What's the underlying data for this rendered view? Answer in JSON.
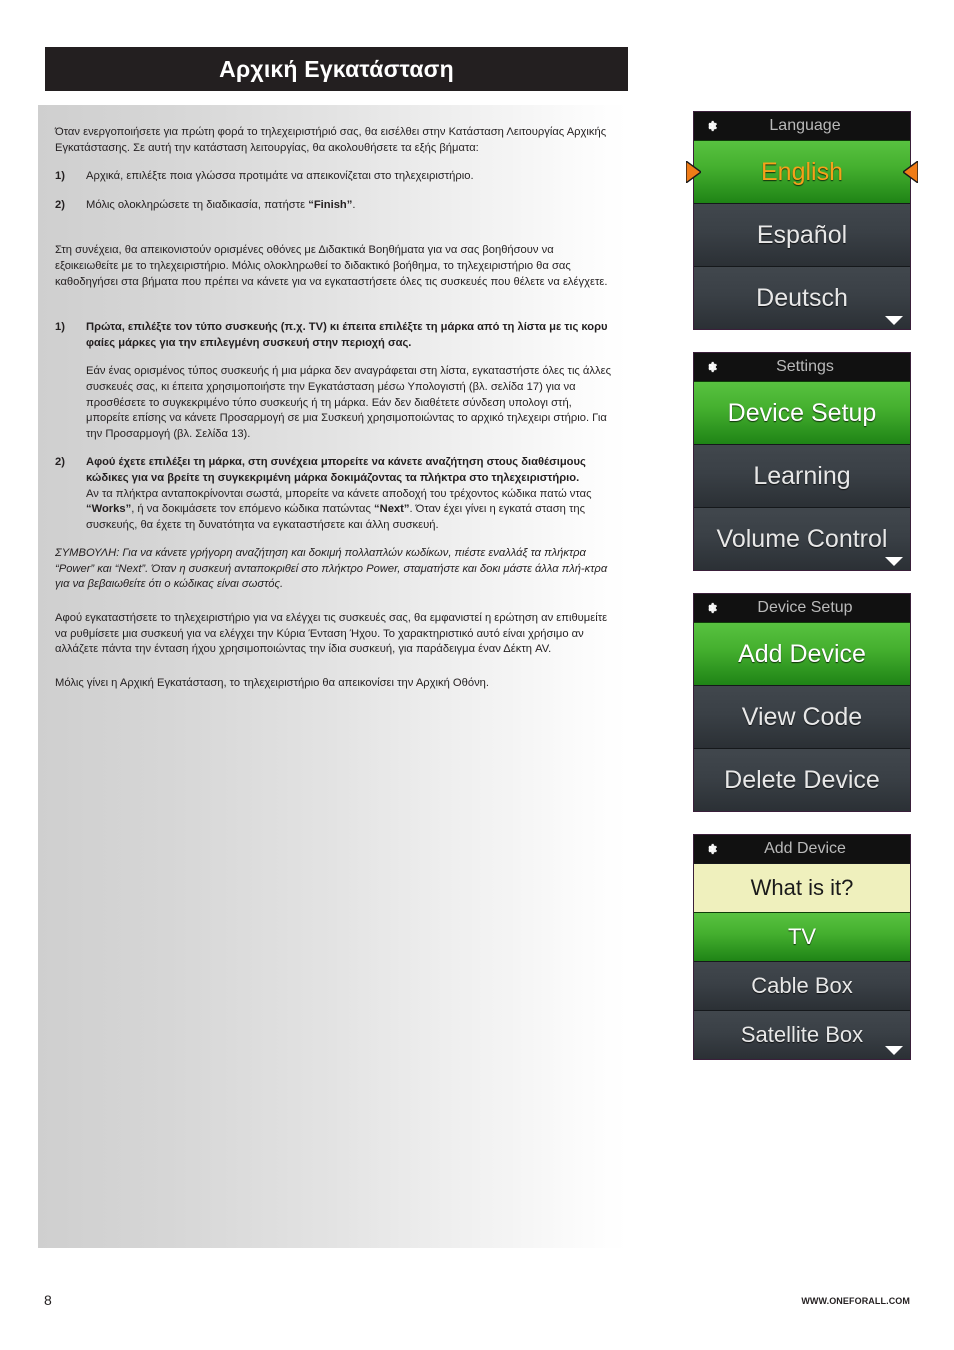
{
  "page": {
    "title": "Αρχική Εγκατάσταση",
    "number": "8",
    "website": "WWW.ONEFORALL.COM"
  },
  "body": {
    "intro": "Όταν ενεργοποιήσετε για πρώτη φορά το τηλεχειριστήριό σας, θα εισέλθει στην Κατάσταση Λειτουργίας Αρχικής Εγκατάστασης. Σε αυτή την κατάσταση λειτουργίας, θα ακολουθήσετε τα εξής βήματα:",
    "step1_num": "1)",
    "step1_text": "Αρχικά, επιλέξτε ποια γλώσσα προτιμάτε να απεικονίζεται στο τηλεχειριστήριο.",
    "step2_num": "2)",
    "step2_text_a": "Μόλις ολοκληρώσετε τη διαδικασία, πατήστε ",
    "step2_text_bold": "“Finish”",
    "step2_text_b": ".",
    "para_tutorials": "Στη συνέχεια, θα απεικονιστούν ορισμένες οθόνες με Διδακτικά Βοηθήματα για να σας βοηθήσουν να εξοικειωθείτε με το τηλεχειριστήριο. Μόλις ολοκληρωθεί το διδακτικό βοήθημα, το τηλεχειριστήριο θα σας καθοδηγήσει στα βήματα που πρέπει να κάνετε για να εγκαταστήσετε όλες τις συσκευές που θέλετε να ελέγχετε.",
    "item1_num": "1)",
    "item1_bold": "Πρώτα, επιλέξτε τον τύπο συσκευής (π.χ. TV) κι έπειτα επιλέξτε τη μάρκα από τη λίστα με τις κορυ φαίες μάρκες για την επιλεγμένη συσκευή στην περιοχή σας.",
    "item1_sub": "Εάν ένας ορισμένος τύπος συσκευής ή μια μάρκα δεν αναγράφεται στη λίστα, εγκαταστήστε όλες τις άλλες συσκευές σας, κι έπειτα χρησιμοποιήστε την Εγκατάσταση μέσω Υπολογιστή (βλ. σελίδα 17) για να προσθέσετε το συγκεκριμένο τύπο συσκευής ή τη μάρκα. Εάν δεν διαθέτετε σύνδεση υπολογι στή, μπορείτε επίσης να κάνετε Προσαρμογή σε μια Συσκευή χρησιμοποιώντας το αρχικό τηλεχειρι στήριο. Για την Προσαρμογή (βλ. Σελίδα 13).",
    "item2_num": "2)",
    "item2_bold": "Αφού έχετε επιλέξει τη μάρκα, στη συνέχεια μπορείτε να κάνετε αναζήτηση στους διαθέσιμους κώδικες για να βρείτε τη συγκεκριμένη μάρκα δοκιμάζοντας τα πλήκτρα στο τηλεχειριστήριο.",
    "item2_rest_a": "Αν τα πλήκτρα ανταποκρίνονται σωστά, μπορείτε να κάνετε αποδοχή του τρέχοντος κώδικα πατώ ντας ",
    "item2_rest_bold1": "“Works”",
    "item2_rest_b": ", ή να δοκιμάσετε τον επόμενο κώδικα πατώντας ",
    "item2_rest_bold2": "“Next”",
    "item2_rest_c": ". Όταν έχει γίνει η εγκατά σταση της συσκευής, θα έχετε τη δυνατότητα να εγκαταστήσετε και άλλη συσκευή.",
    "tip": "ΣΥΜΒΟΥΛΗ: Για να κάνετε γρήγορη αναζήτηση και δοκιμή πολλαπλών κωδίκων, πιέστε εναλλάξ τα πλήκτρα “Power” και “Next”. Όταν η συσκευή ανταποκριθεί στο πλήκτρο Power, σταματήστε και δοκι μάστε άλλα πλή-κτρα για να βεβαιωθείτε ότι ο κώδικας είναι σωστός.",
    "para_volume": "Αφού εγκαταστήσετε το τηλεχειριστήριο για να ελέγχει τις συσκευές σας, θα εμφανιστεί η ερώτηση αν επιθυμείτε να ρυθμίσετε μια συσκευή για να ελέγχει την Κύρια Ένταση Ήχου. Το χαρακτηριστικό αυτό είναι χρήσιμο αν αλλάζετε πάντα την ένταση ήχου χρησιμοποιώντας την ίδια συσκευή, για παράδειγμα έναν Δέκτη AV.",
    "para_final": "Μόλις γίνει η Αρχική Εγκατάσταση, το τηλεχειριστήριο θα απεικονίσει την Αρχική Οθόνη."
  },
  "screens": [
    {
      "id": "language",
      "header": "Language",
      "icon": "gear-icon",
      "has_scroll_down": true,
      "rows": [
        {
          "label": "English",
          "state": "selected",
          "accent": true,
          "side_arrows": true
        },
        {
          "label": "Español",
          "state": "normal",
          "accent": false,
          "side_arrows": false
        },
        {
          "label": "Deutsch",
          "state": "normal",
          "accent": false,
          "side_arrows": false
        }
      ]
    },
    {
      "id": "settings",
      "header": "Settings",
      "icon": "gear-icon",
      "has_scroll_down": true,
      "rows": [
        {
          "label": "Device Setup",
          "state": "selected",
          "accent": false,
          "side_arrows": false
        },
        {
          "label": "Learning",
          "state": "normal",
          "accent": false,
          "side_arrows": false
        },
        {
          "label": "Volume Control",
          "state": "normal",
          "accent": false,
          "side_arrows": false
        }
      ]
    },
    {
      "id": "device-setup",
      "header": "Device Setup",
      "icon": "gear-icon",
      "has_scroll_down": false,
      "rows": [
        {
          "label": "Add Device",
          "state": "selected",
          "accent": false,
          "side_arrows": false
        },
        {
          "label": "View Code",
          "state": "normal",
          "accent": false,
          "side_arrows": false
        },
        {
          "label": "Delete Device",
          "state": "normal",
          "accent": false,
          "side_arrows": false
        }
      ]
    },
    {
      "id": "add-device",
      "header": "Add Device",
      "icon": "gear-icon",
      "has_scroll_down": true,
      "rows": [
        {
          "label": "What is it?",
          "state": "prompt",
          "accent": false,
          "side_arrows": false
        },
        {
          "label": "TV",
          "state": "selected",
          "accent": false,
          "side_arrows": false
        },
        {
          "label": "Cable Box",
          "state": "normal",
          "accent": false,
          "side_arrows": false
        },
        {
          "label": "Satellite Box",
          "state": "normal",
          "accent": false,
          "side_arrows": false
        }
      ]
    }
  ],
  "colors": {
    "title_bar_bg": "#231f20",
    "screen_header_bg": "#111111",
    "row_selected_green": "#45b02f",
    "row_accent_orange": "#f5a11a",
    "row_normal_gray": "#3a4046",
    "row_prompt_yellow": "#eff0bd",
    "side_arrow_orange": "#f07c17"
  }
}
